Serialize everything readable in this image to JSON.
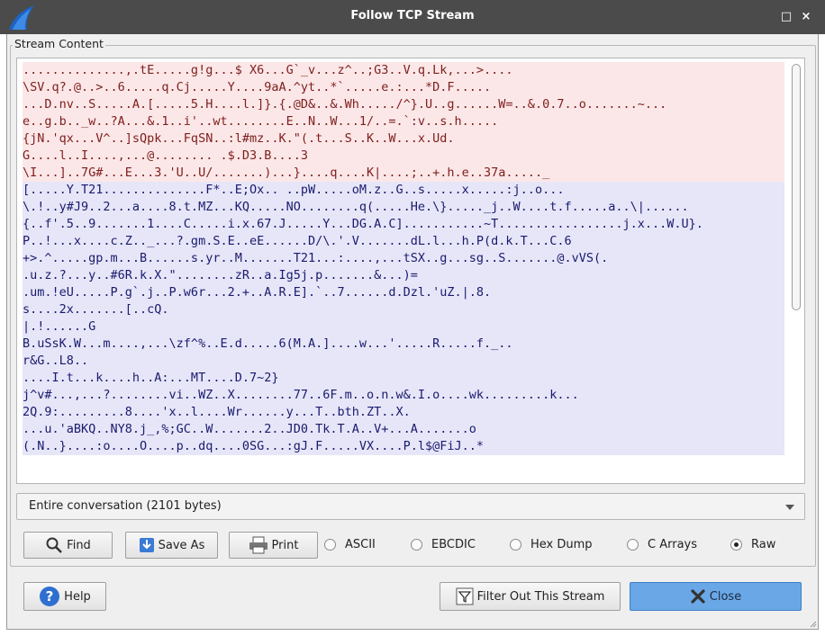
{
  "window": {
    "title": "Follow TCP Stream",
    "controls": {
      "maximize": "□",
      "close": "×"
    }
  },
  "stream": {
    "group_label": "Stream Content",
    "lines": [
      {
        "dir": "client",
        "text": "..............,.tE.....g!g...$ X6...G`_v...z^..;G3..V.q.Lk,...>...."
      },
      {
        "dir": "client",
        "text": "\\SV.q?.@..>..6.....q.Cj.....Y....9aA.^yt..*`.....e.:...*D.F....."
      },
      {
        "dir": "client",
        "text": "...D.nv..S.....A.[.....5.H....l.]}.{.@D&..&.Wh...../^}.U..g......W=..&.0.7..o.......~..."
      },
      {
        "dir": "client",
        "text": "e..g.b.._w..?A...&.1..i'..wt........E..N..W...1/..=.`:v..s.h....."
      },
      {
        "dir": "client",
        "text": "{jN.'qx...V^..]sQpk...FqSN..:l#mz..K.\"(.t...S..K..W...x.Ud."
      },
      {
        "dir": "client",
        "text": "G....l..I....,...@........ .$.D3.B....3"
      },
      {
        "dir": "client",
        "text": "\\I...]..7G#...E...3.'U..U/.......)...}....q....K|....;..+.h.e..37a....._"
      },
      {
        "dir": "server",
        "text": "[.....Y.T21..............F*..E;Ox.. ..pW.....oM.z..G..s.....x.....:j..o..."
      },
      {
        "dir": "server",
        "text": "\\.!..y#J9..2...a....8.t.MZ...KQ.....NO........q(.....He.\\}....._j..W....t.f.....a..\\|......"
      },
      {
        "dir": "server",
        "text": "{..f'.5..9.......1....C.....i.x.67.J.....Y...DG.A.C]...........~T.................j.x...W.U}."
      },
      {
        "dir": "server",
        "text": "P..!...x....c.Z.._...?.gm.S.E..eE......D/\\.'.V.......dL.l...h.P(d.k.T...C.6"
      },
      {
        "dir": "server",
        "text": "+>.^.....gp.m...B......s.yr..M.......T21...:....,...tSX..g...sg..S.......@.vVS(."
      },
      {
        "dir": "server",
        "text": ".u.z.?...y..#6R.k.X.\"........zR..a.Ig5j.p.......&...)="
      },
      {
        "dir": "server",
        "text": ".um.!eU.....P.g`.j..P.w6r...2.+..A.R.E].`..7......d.Dzl.'uZ.|.8."
      },
      {
        "dir": "server",
        "text": "s....2x.......[..cQ."
      },
      {
        "dir": "server",
        "text": "|.!......G"
      },
      {
        "dir": "server",
        "text": "B.uSsK.W...m....,...\\zf^%..E.d.....6(M.A.]....w...'.....R.....f._.."
      },
      {
        "dir": "server",
        "text": "r&G..L8.."
      },
      {
        "dir": "server",
        "text": "....I.t...k....h..A:...MT....D.7~2}"
      },
      {
        "dir": "server",
        "text": "j^v#...,...?........vi..WZ..X........77..6F.m..o.n.w&.I.o....wk.........k..."
      },
      {
        "dir": "server",
        "text": "2Q.9:.........8....'x..l....Wr......y...T..bth.ZT..X."
      },
      {
        "dir": "server",
        "text": "...u.'aBKQ..NY8.j_,%;GC..W.......2..JD0.Tk.T.A..V+...A.......o"
      },
      {
        "dir": "server",
        "text": "(.N..}....:o....O....p..dq....0SG...:gJ.F.....VX....P.l$@FiJ..*"
      }
    ],
    "colors": {
      "client_bg": "#fbe7e7",
      "client_fg": "#7f1d1d",
      "server_bg": "#e6e6f8",
      "server_fg": "#1a1a6e"
    }
  },
  "conversation": {
    "selected": "Entire conversation (2101 bytes)"
  },
  "actions": {
    "find": "Find",
    "save_as": "Save As",
    "print": "Print"
  },
  "formats": [
    {
      "label": "ASCII",
      "selected": false
    },
    {
      "label": "EBCDIC",
      "selected": false
    },
    {
      "label": "Hex Dump",
      "selected": false
    },
    {
      "label": "C Arrays",
      "selected": false
    },
    {
      "label": "Raw",
      "selected": true
    }
  ],
  "footer": {
    "help": "Help",
    "filter": "Filter Out This Stream",
    "close": "Close"
  },
  "icons": {
    "app": "wireshark-fin-icon",
    "find": "magnifier-icon",
    "save": "save-down-arrow-icon",
    "print": "printer-icon",
    "help": "help-question-icon",
    "filter": "filter-funnel-icon",
    "close": "close-x-icon"
  }
}
